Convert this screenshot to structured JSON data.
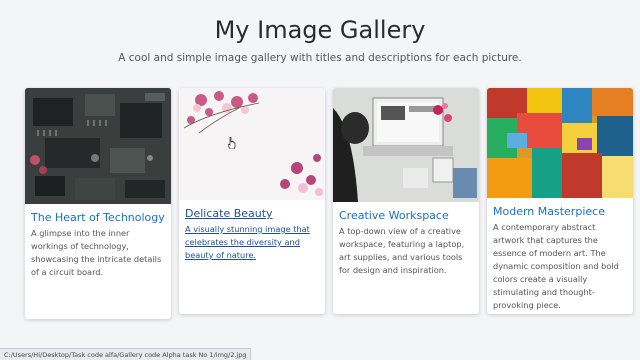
{
  "header": {
    "title": "My Image Gallery",
    "subtitle": "A cool and simple image gallery with titles and descriptions for each picture."
  },
  "cards": [
    {
      "title": "The Heart of Technology",
      "description": "A glimpse into the inner workings of technology, showcasing the intricate details of a circuit board.",
      "image_icon": "circuit-board-image"
    },
    {
      "title": "Delicate Beauty",
      "description": "A visually stunning image that celebrates the diversity and beauty of nature.",
      "image_icon": "flowers-image"
    },
    {
      "title": "Creative Workspace",
      "description": "A top-down view of a creative workspace, featuring a laptop, art supplies, and various tools for design and inspiration.",
      "image_icon": "workspace-image"
    },
    {
      "title": "Modern Masterpiece",
      "description": "A contemporary abstract artwork that captures the essence of modern art. The dynamic composition and bold colors create a visually stimulating and thought-provoking piece.",
      "image_icon": "abstract-painting-image"
    }
  ],
  "statusbar": {
    "url": "C:/Users/Hi/Desktop/Task code alfa/Gallery code Alpha task No 1/img/2.jpg"
  },
  "colors": {
    "link": "#1a6fc2",
    "background": "#f4f5f7"
  }
}
